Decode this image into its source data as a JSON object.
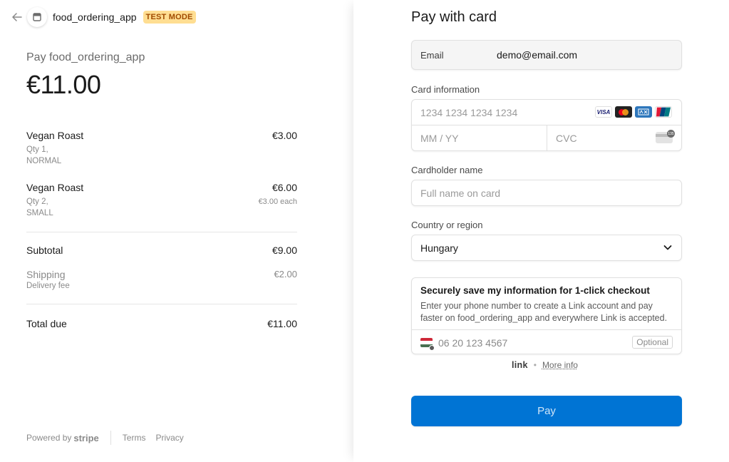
{
  "header": {
    "merchant_name": "food_ordering_app",
    "mode_badge": "TEST MODE"
  },
  "summary": {
    "pay_label": "Pay food_ordering_app",
    "total_amount": "€11.00",
    "items": [
      {
        "name": "Vegan Roast",
        "price": "€3.00",
        "qty": "Qty 1,",
        "variant": "NORMAL",
        "unit_price": ""
      },
      {
        "name": "Vegan Roast",
        "price": "€6.00",
        "qty": "Qty 2,",
        "variant": "SMALL",
        "unit_price": "€3.00 each"
      }
    ],
    "subtotal_label": "Subtotal",
    "subtotal_value": "€9.00",
    "shipping_label": "Shipping",
    "shipping_sub": "Delivery fee",
    "shipping_value": "€2.00",
    "total_label": "Total due",
    "total_value": "€11.00"
  },
  "footer": {
    "powered_by": "Powered by",
    "stripe": "stripe",
    "terms": "Terms",
    "privacy": "Privacy"
  },
  "form": {
    "title": "Pay with card",
    "email_label": "Email",
    "email_value": "demo@email.com",
    "card_label": "Card information",
    "card_number_placeholder": "1234 1234 1234 1234",
    "expiry_placeholder": "MM / YY",
    "cvc_placeholder": "CVC",
    "card_brands": [
      "VISA",
      "mastercard",
      "AMEX",
      "UnionPay"
    ],
    "cardholder_label": "Cardholder name",
    "cardholder_placeholder": "Full name on card",
    "country_label": "Country or region",
    "country_value": "Hungary",
    "link_title": "Securely save my information for 1-click checkout",
    "link_description": "Enter your phone number to create a Link account and pay faster on food_ordering_app and everywhere Link is accepted.",
    "phone_value": "06 20 123 4567",
    "optional_label": "Optional",
    "link_brand": "link",
    "more_info": "More info",
    "pay_button": "Pay"
  },
  "colors": {
    "accent": "#0074d4",
    "badge_bg": "#ffde92",
    "badge_text": "#a04b00"
  },
  "icons": [
    "back-arrow-icon",
    "store-icon",
    "chevron-down-icon",
    "hungary-flag-icon",
    "cvc-card-icon"
  ]
}
